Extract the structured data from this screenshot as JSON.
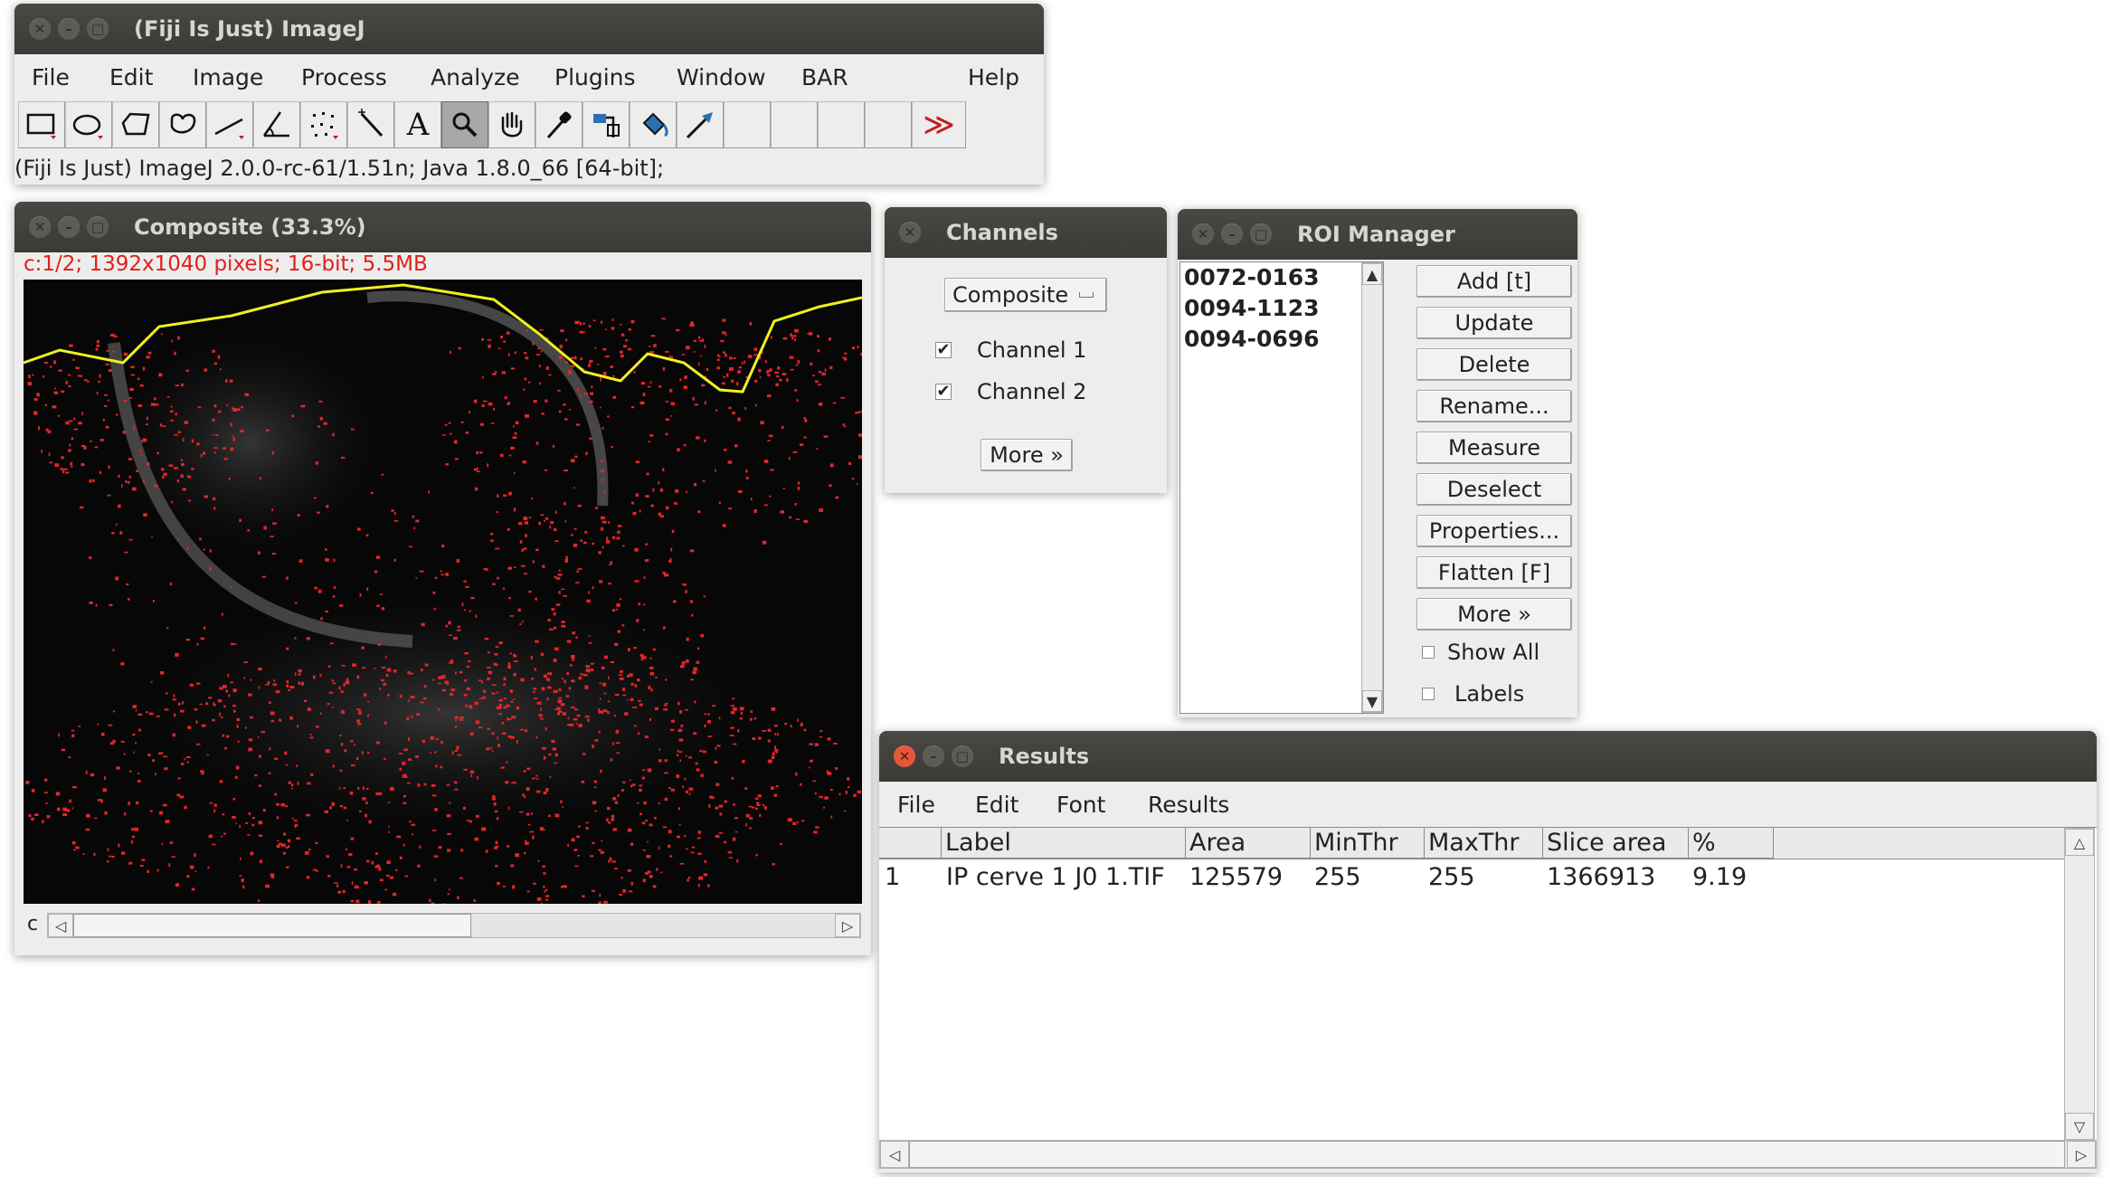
{
  "imagej": {
    "title": "(Fiji Is Just) ImageJ",
    "menu": [
      "File",
      "Edit",
      "Image",
      "Process",
      "Analyze",
      "Plugins",
      "Window",
      "BAR",
      "Help"
    ],
    "status": "(Fiji Is Just) ImageJ 2.0.0-rc-61/1.51n; Java 1.8.0_66 [64-bit];",
    "tools": [
      "rectangle-tool-icon",
      "oval-tool-icon",
      "polygon-tool-icon",
      "freehand-tool-icon",
      "line-tool-icon",
      "angle-tool-icon",
      "multipoint-tool-icon",
      "wand-tool-icon",
      "text-tool-icon",
      "magnifier-tool-icon",
      "hand-tool-icon",
      "color-picker-icon",
      "macro-tool-icon",
      "fill-tool-icon",
      "arrow-tool-icon"
    ],
    "text_tool_glyph": "A",
    "more_tools_glyph": "≫"
  },
  "composite": {
    "title": "Composite (33.3%)",
    "info": "c:1/2; 1392x1040 pixels; 16-bit; 5.5MB",
    "channel_label": "c"
  },
  "channels": {
    "title": "Channels",
    "mode": "Composite",
    "items": [
      {
        "label": "Channel 1",
        "checked": true
      },
      {
        "label": "Channel 2",
        "checked": true
      }
    ],
    "more": "More »"
  },
  "roi_manager": {
    "title": "ROI Manager",
    "rois": [
      "0072-0163",
      "0094-1123",
      "0094-0696"
    ],
    "buttons": [
      "Add [t]",
      "Update",
      "Delete",
      "Rename...",
      "Measure",
      "Deselect",
      "Properties...",
      "Flatten [F]",
      "More »"
    ],
    "checkboxes": [
      {
        "label": "Show All",
        "checked": false
      },
      {
        "label": "Labels",
        "checked": false
      }
    ]
  },
  "results": {
    "title": "Results",
    "menu": [
      "File",
      "Edit",
      "Font",
      "Results"
    ],
    "columns": [
      "",
      "Label",
      "Area",
      "MinThr",
      "MaxThr",
      "Slice area",
      "%"
    ],
    "rows": [
      [
        "1",
        "IP cerve 1 J0 1.TIF",
        "125579",
        "255",
        "255",
        "1366913",
        "9.19"
      ]
    ]
  },
  "colors": {
    "titlebar": "#3f3e3a",
    "info_text": "#e0201a",
    "roi_outline": "#f0f020",
    "signal": "#e3262a"
  }
}
